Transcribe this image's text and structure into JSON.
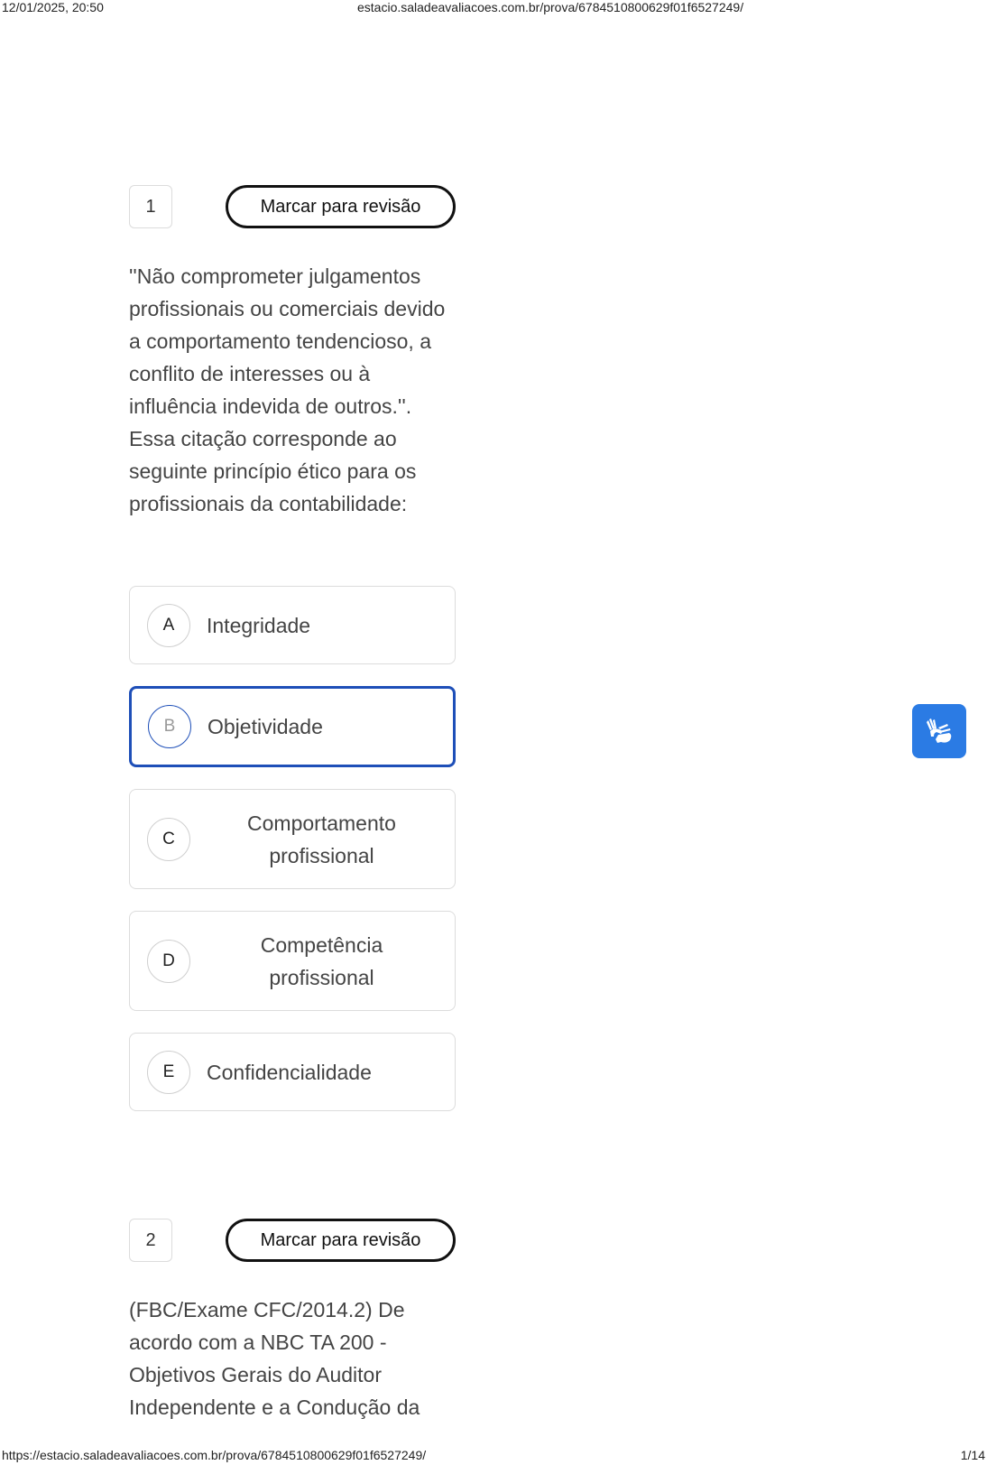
{
  "print_header": {
    "datetime": "12/01/2025, 20:50",
    "url": "estacio.saladeavaliacoes.com.br/prova/6784510800629f01f6527249/"
  },
  "print_footer": {
    "url": "https://estacio.saladeavaliacoes.com.br/prova/6784510800629f01f6527249/",
    "page": "1/14"
  },
  "questions": [
    {
      "number": "1",
      "review_label": "Marcar para revisão",
      "text": "''Não comprometer julgamentos profissionais ou comerciais devido a comportamento tendencioso, a conflito de interesses ou à influência indevida de outros.''. Essa citação corresponde ao seguinte princípio ético para os profissionais da contabilidade:",
      "options": [
        {
          "letter": "A",
          "label": "Integridade"
        },
        {
          "letter": "B",
          "label": "Objetividade",
          "selected": true
        },
        {
          "letter": "C",
          "label": "Comportamento profissional"
        },
        {
          "letter": "D",
          "label": "Competência profissional"
        },
        {
          "letter": "E",
          "label": "Confidencialidade"
        }
      ]
    },
    {
      "number": "2",
      "review_label": "Marcar para revisão",
      "text": "(FBC/Exame CFC/2014.2) De acordo com a NBC TA 200 - Objetivos Gerais do Auditor Independente e a Condução da"
    }
  ],
  "accessibility_button": {
    "icon": "sign-language-icon",
    "color": "#2b7be4"
  },
  "colors": {
    "selected_border": "#1e4fb8",
    "text": "#444444"
  }
}
